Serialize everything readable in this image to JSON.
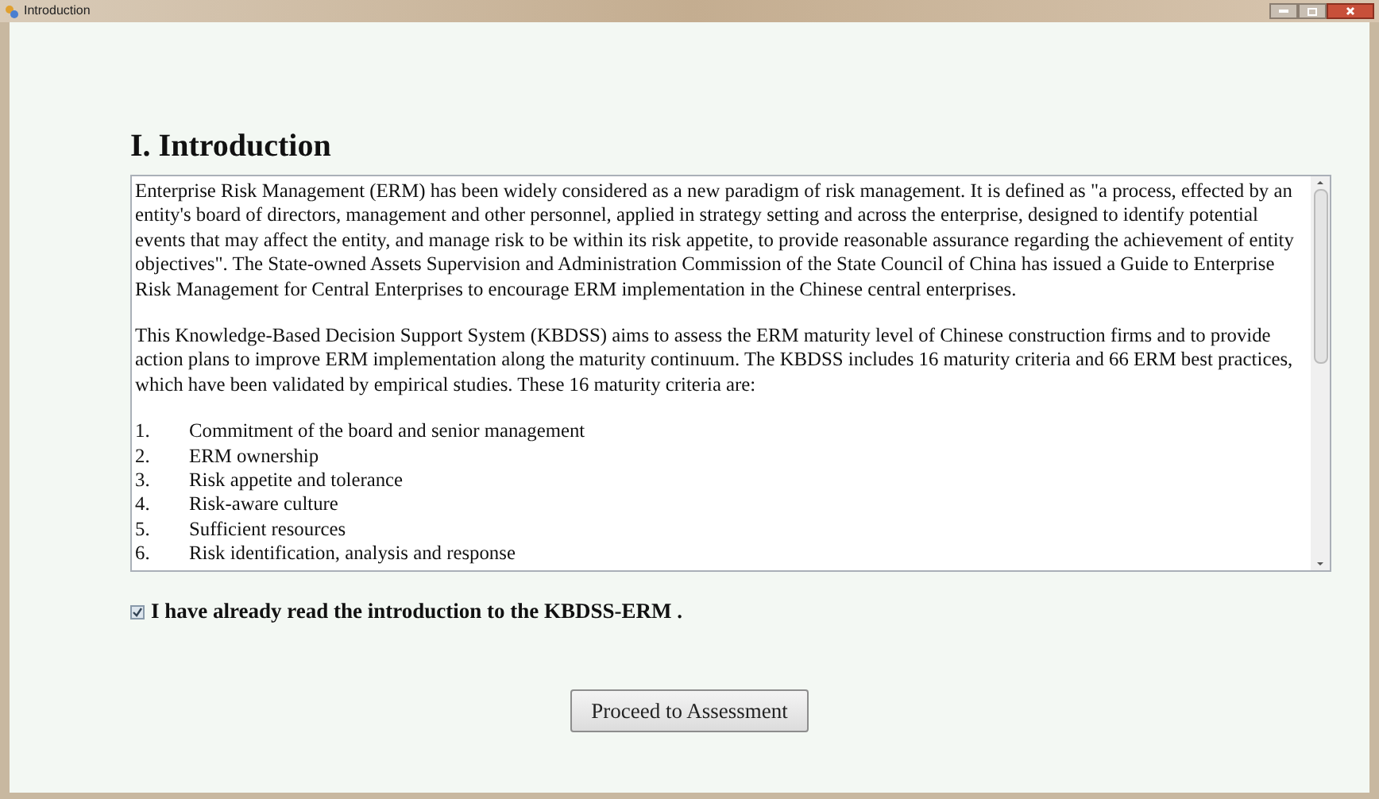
{
  "window": {
    "title": "Introduction"
  },
  "heading": "I. Introduction",
  "paragraphs": [
    "Enterprise Risk Management (ERM) has been widely considered as a new paradigm of risk management. It is defined as \"a process, effected by an entity's board of directors, management and other personnel, applied in strategy setting and across the enterprise, designed to identify potential events that may affect the entity, and manage risk to be within its risk appetite, to provide reasonable assurance regarding the achievement of entity objectives\". The State-owned Assets Supervision and Administration Commission of the State Council of China has issued a Guide to Enterprise Risk Management for Central Enterprises to encourage ERM implementation in the Chinese central enterprises.",
    "This Knowledge-Based Decision Support System (KBDSS) aims to assess the ERM maturity level of Chinese construction firms and to provide action plans to improve ERM implementation along the maturity continuum. The KBDSS includes 16 maturity criteria and 66 ERM best practices, which have been validated by empirical studies. These 16 maturity criteria are:"
  ],
  "criteria": [
    {
      "number": "1.",
      "text": "Commitment of the board and senior management"
    },
    {
      "number": "2.",
      "text": "ERM ownership"
    },
    {
      "number": "3.",
      "text": "Risk appetite and tolerance"
    },
    {
      "number": "4.",
      "text": "Risk-aware culture"
    },
    {
      "number": "5.",
      "text": "Sufficient resources"
    },
    {
      "number": "6.",
      "text": "Risk identification, analysis and response"
    }
  ],
  "confirmation": {
    "label": "I have already read the introduction to the KBDSS-ERM .",
    "checked": true
  },
  "button": "Proceed to Assessment"
}
